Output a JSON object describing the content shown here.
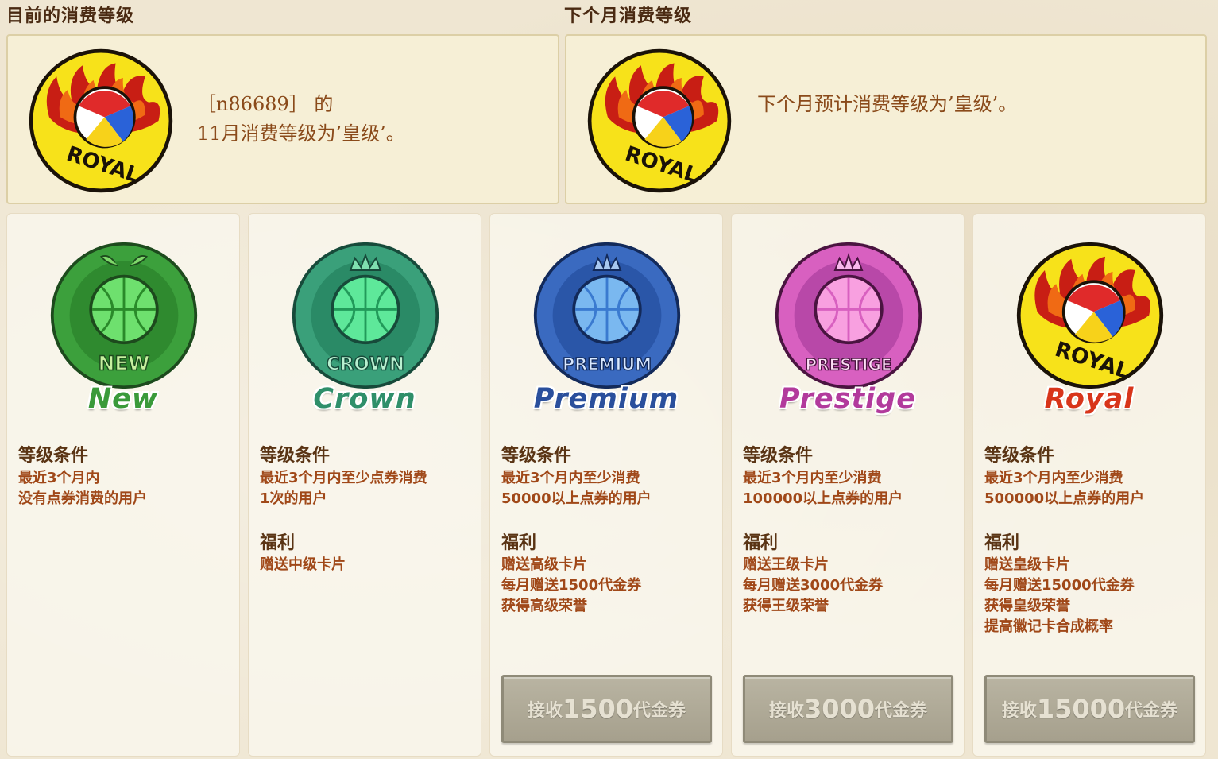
{
  "current": {
    "title": "目前的消费等级",
    "line1": "［n86689］ 的",
    "line2": "11月消费等级为’皇级’。",
    "badge_text": "ROYAL"
  },
  "next": {
    "title": "下个月消费等级",
    "line1": "下个月预计消费等级为’皇级’。",
    "badge_text": "ROYAL"
  },
  "labels": {
    "condition": "等级条件",
    "benefit": "福利"
  },
  "tiers": [
    {
      "name": "New",
      "badge_text": "NEW",
      "color": "#3a9a3a",
      "condition": [
        "最近3个月内",
        "没有点券消费的用户"
      ],
      "benefits": []
    },
    {
      "name": "Crown",
      "badge_text": "CROWN",
      "color": "#2f8f6a",
      "condition": [
        "最近3个月内至少点券消费",
        "1次的用户"
      ],
      "benefits": [
        "赠送中级卡片"
      ]
    },
    {
      "name": "Premium",
      "badge_text": "PREMIUM",
      "color": "#2a4f9c",
      "condition": [
        "最近3个月内至少消费",
        "50000以上点券的用户"
      ],
      "benefits": [
        "赠送高级卡片",
        "每月赠送1500代金券",
        "获得高级荣誉"
      ],
      "button": {
        "prefix": "接收",
        "amount": "1500",
        "suffix": "代金券"
      }
    },
    {
      "name": "Prestige",
      "badge_text": "PRESTIGE",
      "color": "#b23a9c",
      "condition": [
        "最近3个月内至少消费",
        "100000以上点券的用户"
      ],
      "benefits": [
        "赠送王级卡片",
        "每月赠送3000代金券",
        "获得王级荣誉"
      ],
      "button": {
        "prefix": "接收",
        "amount": "3000",
        "suffix": "代金券"
      }
    },
    {
      "name": "Royal",
      "badge_text": "ROYAL",
      "color": "#d8351a",
      "condition": [
        "最近3个月内至少消费",
        "500000以上点券的用户"
      ],
      "benefits": [
        "赠送皇级卡片",
        "每月赠送15000代金券",
        "获得皇级荣誉",
        "提高徽记卡合成概率"
      ],
      "button": {
        "prefix": "接收",
        "amount": "15000",
        "suffix": "代金券"
      }
    }
  ]
}
